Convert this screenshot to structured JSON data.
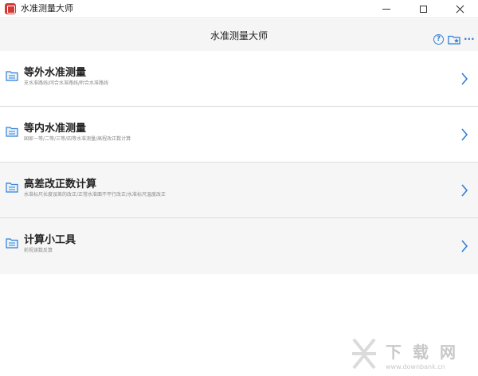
{
  "window": {
    "title": "水准测量大师",
    "icons": {
      "app": "app-logo-icon",
      "minimize": "minimize-icon",
      "maximize": "maximize-icon",
      "close": "close-icon"
    }
  },
  "header": {
    "title": "水准测量大师",
    "help_glyph": "?",
    "more_glyph": "···",
    "icons": {
      "help": "help-circle-icon",
      "favorites": "folder-star-icon",
      "more": "more-dots-icon"
    }
  },
  "menu": {
    "items": [
      {
        "title": "等外水准测量",
        "subtitle": "支水准路线/闭合水准路线/附合水准路线",
        "icon": "folder-icon"
      },
      {
        "title": "等内水准测量",
        "subtitle": "国家一等/二等/三等/四等水准测量/高程改正数计算",
        "icon": "folder-icon"
      },
      {
        "title": "高差改正数计算",
        "subtitle": "水准标尺长度误差的改正/正常水准面不平行改正/水准标尺温度改正",
        "icon": "folder-icon"
      },
      {
        "title": "计算小工具",
        "subtitle": "前视读数反算",
        "icon": "folder-icon"
      }
    ]
  },
  "watermark": {
    "text": "下载网",
    "url": "www.downbank.cn"
  },
  "colors": {
    "accent": "#2f7fd6",
    "app_red": "#d13a35",
    "header_bg": "#f5f5f5"
  }
}
